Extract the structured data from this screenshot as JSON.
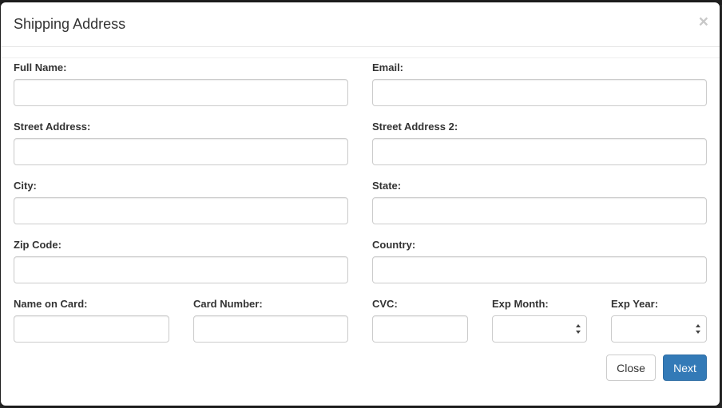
{
  "modal": {
    "title": "Shipping Address",
    "close_glyph": "×"
  },
  "form": {
    "full_name": {
      "label": "Full Name:",
      "value": "",
      "placeholder": ""
    },
    "email": {
      "label": "Email:",
      "value": "",
      "placeholder": ""
    },
    "street_address": {
      "label": "Street Address:",
      "value": "",
      "placeholder": ""
    },
    "street_address_2": {
      "label": "Street Address 2:",
      "value": "",
      "placeholder": ""
    },
    "city": {
      "label": "City:",
      "value": "",
      "placeholder": ""
    },
    "state": {
      "label": "State:",
      "value": "",
      "placeholder": ""
    },
    "zip_code": {
      "label": "Zip Code:",
      "value": "",
      "placeholder": ""
    },
    "country": {
      "label": "Country:",
      "value": "",
      "placeholder": ""
    },
    "name_on_card": {
      "label": "Name on Card:",
      "value": "",
      "placeholder": ""
    },
    "card_number": {
      "label": "Card Number:",
      "value": "",
      "placeholder": ""
    },
    "cvc": {
      "label": "CVC:",
      "value": "",
      "placeholder": ""
    },
    "exp_month": {
      "label": "Exp Month:",
      "selected": ""
    },
    "exp_year": {
      "label": "Exp Year:",
      "selected": ""
    }
  },
  "footer": {
    "close_label": "Close",
    "next_label": "Next"
  },
  "colors": {
    "primary": "#337ab7",
    "border": "#cccccc",
    "text": "#333333"
  },
  "icons": {
    "close": "close-icon",
    "select": "select-arrows-icon"
  }
}
